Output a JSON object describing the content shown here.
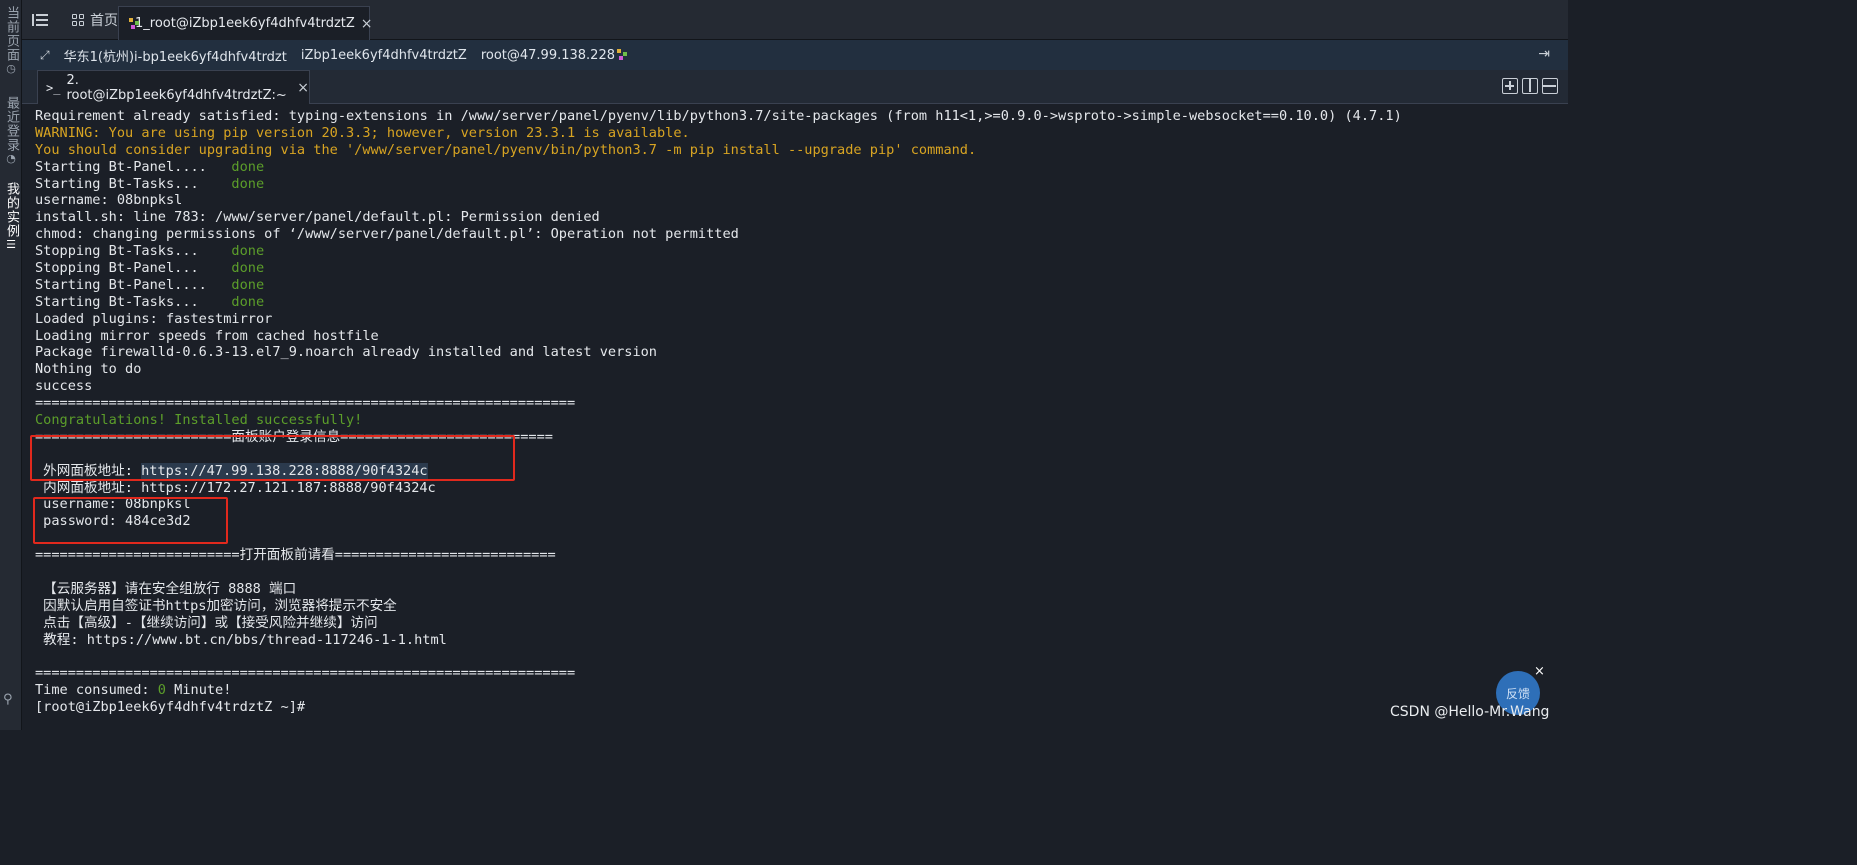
{
  "sidebar": {
    "items": [
      {
        "label": "当前页面",
        "icon": "clock-icon"
      },
      {
        "label": "最近登录",
        "icon": "history-icon"
      },
      {
        "label": "我的实例",
        "icon": "list-icon"
      }
    ],
    "pin_icon": "pin-icon"
  },
  "tabbar": {
    "home_label": "首页",
    "session_tab_label": "1_root@iZbp1eek6yf4dhfv4trdztZ",
    "close_glyph": "×"
  },
  "infobar": {
    "region": "华东1(杭州)i-bp1eek6yf4dhfv4trdzt",
    "hostname": "iZbp1eek6yf4dhfv4trdztZ",
    "user_ip": "root@47.99.138.228"
  },
  "terminal_tab": {
    "label": "2. root@iZbp1eek6yf4dhfv4trdztZ:~",
    "close_glyph": "×"
  },
  "terminal": {
    "lines": [
      {
        "text": "Requirement already satisfied: typing-extensions in /www/server/panel/pyenv/lib/python3.7/site-packages (from h11<1,>=0.9.0->wsproto->simple-websocket==0.10.0) (4.7.1)"
      },
      {
        "text": "WARNING: You are using pip version 20.3.3; however, version 23.3.1 is available.",
        "style": "yellow"
      },
      {
        "text": "You should consider upgrading via the '/www/server/panel/pyenv/bin/python3.7 -m pip install --upgrade pip' command.",
        "style": "yellow"
      },
      {
        "text": "Starting Bt-Panel....   ",
        "status": "done"
      },
      {
        "text": "Starting Bt-Tasks...    ",
        "status": "done"
      },
      {
        "text": "username: 08bnpksl"
      },
      {
        "text": "install.sh: line 783: /www/server/panel/default.pl: Permission denied"
      },
      {
        "text": "chmod: changing permissions of ‘/www/server/panel/default.pl’: Operation not permitted"
      },
      {
        "text": "Stopping Bt-Tasks...    ",
        "status": "done"
      },
      {
        "text": "Stopping Bt-Panel...    ",
        "status": "done"
      },
      {
        "text": "Starting Bt-Panel....   ",
        "status": "done"
      },
      {
        "text": "Starting Bt-Tasks...    ",
        "status": "done"
      },
      {
        "text": "Loaded plugins: fastestmirror"
      },
      {
        "text": "Loading mirror speeds from cached hostfile"
      },
      {
        "text": "Package firewalld-0.6.3-13.el7_9.noarch already installed and latest version"
      },
      {
        "text": "Nothing to do"
      },
      {
        "text": "success"
      },
      {
        "text": "=================================================================="
      },
      {
        "text": "Congratulations! Installed successfully!",
        "style": "green"
      },
      {
        "text": "========================面板账户登录信息=========================="
      },
      {
        "text": ""
      },
      {
        "text": " 外网面板地址: ",
        "link": "https://47.99.138.228:8888/90f4324c"
      },
      {
        "text": " 内网面板地址: https://172.27.121.187:8888/90f4324c"
      },
      {
        "text": " username: 08bnpksl"
      },
      {
        "text": " password: 484ce3d2"
      },
      {
        "text": ""
      },
      {
        "text": "=========================打开面板前请看==========================="
      },
      {
        "text": ""
      },
      {
        "text": " 【云服务器】请在安全组放行 8888 端口"
      },
      {
        "text": " 因默认启用自签证书https加密访问，浏览器将提示不安全"
      },
      {
        "text": " 点击【高级】-【继续访问】或【接受风险并继续】访问"
      },
      {
        "text": " 教程: https://www.bt.cn/bbs/thread-117246-1-1.html"
      },
      {
        "text": ""
      },
      {
        "text": "=================================================================="
      },
      {
        "text": "Time consumed: ",
        "num": "0",
        "suffix": " Minute!"
      },
      {
        "text": "[root@iZbp1eek6yf4dhfv4trdztZ ~]#"
      }
    ]
  },
  "feedback": {
    "label": "反馈",
    "close_glyph": "×"
  },
  "watermark": "CSDN @Hello-Mr.Wang",
  "colors": {
    "terminal_bg": "#1b1f27",
    "warning": "#d8a422",
    "success": "#5c9e2a",
    "highlight_box": "#e1291d"
  }
}
